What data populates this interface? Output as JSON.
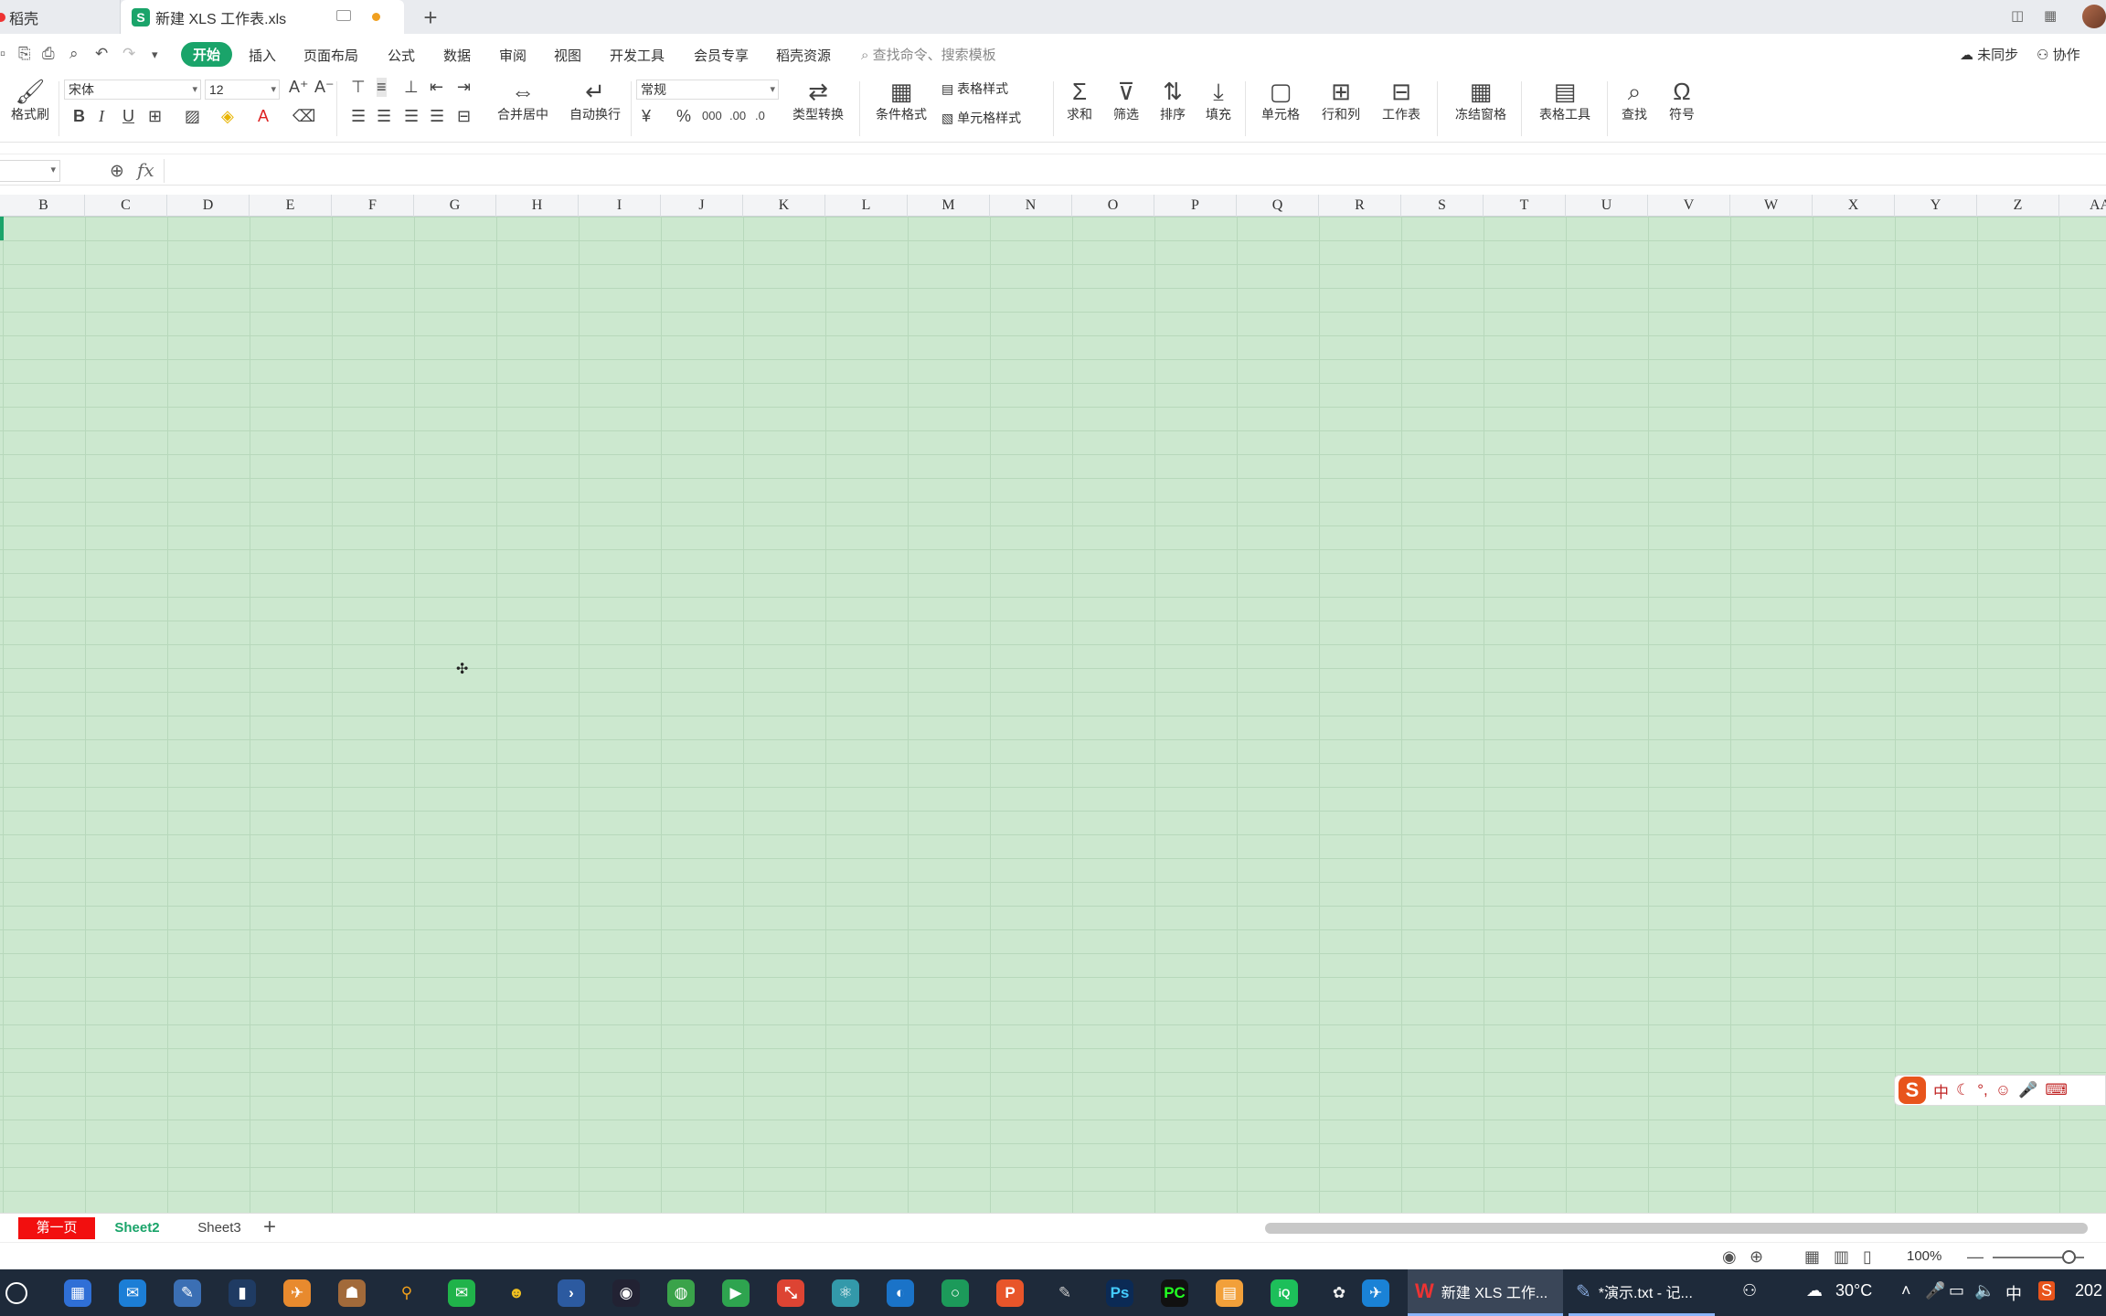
{
  "window": {
    "tabs": [
      {
        "label": "稻壳"
      },
      {
        "label": "新建 XLS 工作表.xls"
      }
    ]
  },
  "menu": {
    "start": "开始",
    "items": [
      "插入",
      "页面布局",
      "公式",
      "数据",
      "审阅",
      "视图",
      "开发工具",
      "会员专享",
      "稻壳资源"
    ],
    "search_placeholder": "查找命令、搜索模板",
    "sync": "未同步",
    "collab": "协作"
  },
  "ribbon": {
    "format_painter": "格式刷",
    "font_name": "宋体",
    "font_size": "12",
    "merge_center": "合并居中",
    "wrap_text": "自动换行",
    "number_format": "常规",
    "type_convert": "类型转换",
    "conditional_format": "条件格式",
    "table_style": "表格样式",
    "cell_style": "单元格样式",
    "sum": "求和",
    "filter": "筛选",
    "sort": "排序",
    "fill": "填充",
    "cell": "单元格",
    "row_col": "行和列",
    "worksheet": "工作表",
    "freeze": "冻结窗格",
    "table_tools": "表格工具",
    "find": "查找",
    "symbol": "符号"
  },
  "formula_bar": {
    "fx": "fx",
    "value": ""
  },
  "columns": [
    "B",
    "C",
    "D",
    "E",
    "F",
    "G",
    "H",
    "I",
    "J",
    "K",
    "L",
    "M",
    "N",
    "O",
    "P",
    "Q",
    "R",
    "S",
    "T",
    "U",
    "V",
    "W",
    "X",
    "Y",
    "Z",
    "AA"
  ],
  "sheets": [
    {
      "name": "第一页",
      "color": "#f20f0f"
    },
    {
      "name": "Sheet2",
      "active": true
    },
    {
      "name": "Sheet3"
    }
  ],
  "status": {
    "zoom": "100%"
  },
  "ime": {
    "mode": "中"
  },
  "taskbar": {
    "wps_window": "新建 XLS 工作...",
    "notepad_window": "*演示.txt - 记...",
    "weather": "30°C",
    "input_lang": "中",
    "clock": "202"
  },
  "colors": {
    "accent": "#1aa46a",
    "grid_bg": "#cce8cf",
    "first_sheet": "#f20f0f"
  }
}
